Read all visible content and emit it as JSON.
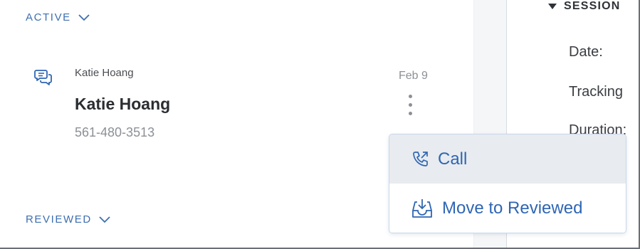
{
  "sections": {
    "active_label": "ACTIVE",
    "reviewed_label": "REVIEWED"
  },
  "conversation": {
    "contact_small": "Katie Hoang",
    "contact_name": "Katie Hoang",
    "phone": "561-480-3513",
    "date": "Feb 9",
    "icon": "chat-bubbles-icon"
  },
  "menu": {
    "call_label": "Call",
    "move_label": "Move to Reviewed",
    "call_icon": "phone-outgoing-icon",
    "move_icon": "inbox-download-icon"
  },
  "session_panel": {
    "title": "SESSION",
    "date_label": "Date:",
    "tracking_label": "Tracking",
    "duration_label": "Duration:"
  },
  "colors": {
    "accent": "#2f66b3",
    "section_header": "#3d6fb0",
    "menu_hover": "#e8ebef",
    "muted_text": "#8c9096"
  }
}
